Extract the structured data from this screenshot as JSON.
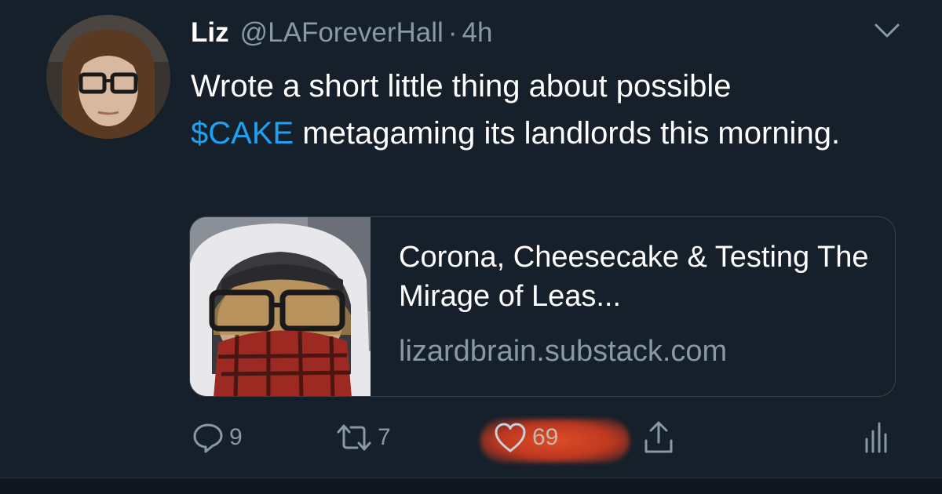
{
  "tweet": {
    "author_name": "Liz",
    "handle": "@LAForeverHall",
    "separator": "·",
    "time": "4h",
    "text_before": "Wrote a short little thing about possible",
    "cashtag": "$CAKE",
    "text_after": " metagaming its landlords this morning."
  },
  "card": {
    "title": "Corona, Cheesecake & Testing The Mirage of Leas...",
    "domain": "lizardbrain.substack.com"
  },
  "actions": {
    "reply_count": "9",
    "retweet_count": "7",
    "like_count": "69"
  },
  "icons": {
    "reply": "reply-icon",
    "retweet": "retweet-icon",
    "like": "heart-icon",
    "share": "share-icon",
    "analytics": "analytics-icon",
    "more": "chevron-down-icon"
  },
  "colors": {
    "background": "#15202b",
    "accent": "#1da1f2",
    "muted": "#8899a6",
    "border": "#38444d",
    "text": "#ffffff"
  }
}
